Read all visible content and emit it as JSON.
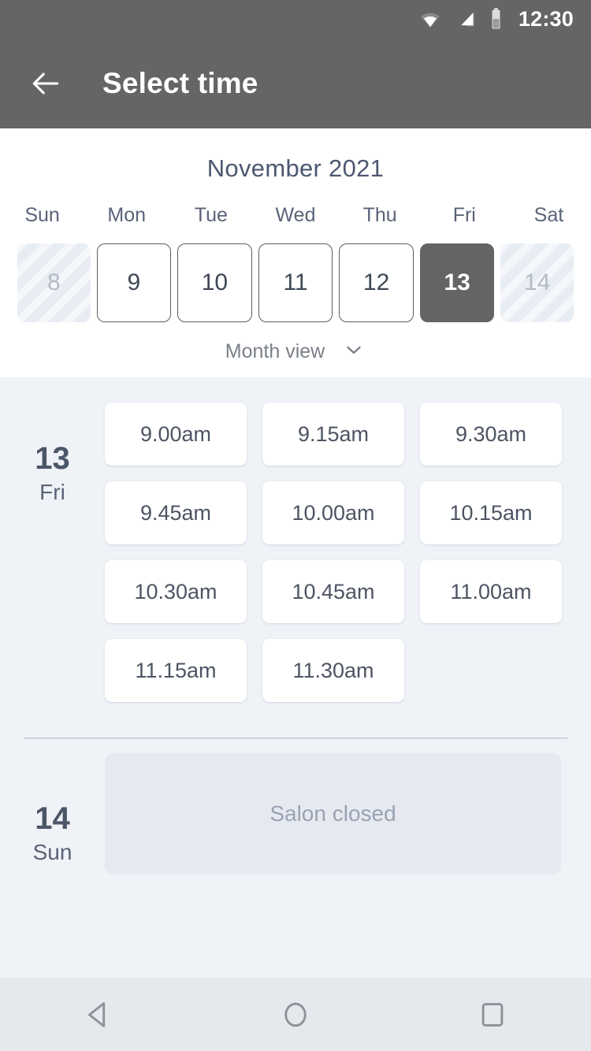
{
  "statusbar": {
    "time": "12:30",
    "icons": [
      "wifi-icon",
      "cellular-signal-icon",
      "battery-icon"
    ]
  },
  "appbar": {
    "back_icon": "arrow-left-icon",
    "title": "Select time",
    "background": "#656565"
  },
  "calendar": {
    "month_title": "November 2021",
    "weekday_headers": [
      "Sun",
      "Mon",
      "Tue",
      "Wed",
      "Thu",
      "Fri",
      "Sat"
    ],
    "days": [
      {
        "number": "8",
        "state": "disabled"
      },
      {
        "number": "9",
        "state": "available"
      },
      {
        "number": "10",
        "state": "available"
      },
      {
        "number": "11",
        "state": "available"
      },
      {
        "number": "12",
        "state": "available"
      },
      {
        "number": "13",
        "state": "selected"
      },
      {
        "number": "14",
        "state": "disabled"
      }
    ],
    "view_toggle": {
      "label": "Month view",
      "icon": "chevron-down-icon"
    },
    "selected_color": "#646464",
    "title_color": "#4d5871"
  },
  "schedule": [
    {
      "day_number": "13",
      "day_name": "Fri",
      "status": "open",
      "slots": [
        "9.00am",
        "9.15am",
        "9.30am",
        "9.45am",
        "10.00am",
        "10.15am",
        "10.30am",
        "10.45am",
        "11.00am",
        "11.15am",
        "11.30am"
      ]
    },
    {
      "day_number": "14",
      "day_name": "Sun",
      "status": "closed",
      "closed_message": "Salon closed"
    }
  ],
  "navbar": {
    "back_icon": "triangle-back-icon",
    "home_icon": "circle-home-icon",
    "recents_icon": "square-recents-icon"
  }
}
